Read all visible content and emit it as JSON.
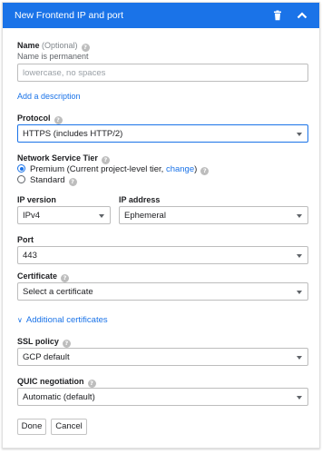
{
  "header": {
    "title": "New Frontend IP and port",
    "delete_icon": "trash-icon",
    "collapse_icon": "chevron-up-icon",
    "color": "#1a73e8"
  },
  "name": {
    "label": "Name",
    "optional": "(Optional)",
    "hint": "Name is permanent",
    "placeholder": "lowercase, no spaces",
    "value": ""
  },
  "add_description_link": "Add a description",
  "protocol": {
    "label": "Protocol",
    "value": "HTTPS (includes HTTP/2)"
  },
  "network_tier": {
    "label": "Network Service Tier",
    "options": [
      {
        "label": "Premium (Current project-level tier, ",
        "link": "change",
        "suffix": ")",
        "selected": true
      },
      {
        "label": "Standard",
        "selected": false
      }
    ]
  },
  "ip_version": {
    "label": "IP version",
    "value": "IPv4"
  },
  "ip_address": {
    "label": "IP address",
    "value": "Ephemeral"
  },
  "port": {
    "label": "Port",
    "value": "443"
  },
  "certificate": {
    "label": "Certificate",
    "value": "Select a certificate"
  },
  "additional_certificates_link": "Additional certificates",
  "ssl_policy": {
    "label": "SSL policy",
    "value": "GCP default"
  },
  "quic": {
    "label": "QUIC negotiation",
    "value": "Automatic (default)"
  },
  "actions": {
    "done": "Done",
    "cancel": "Cancel"
  }
}
